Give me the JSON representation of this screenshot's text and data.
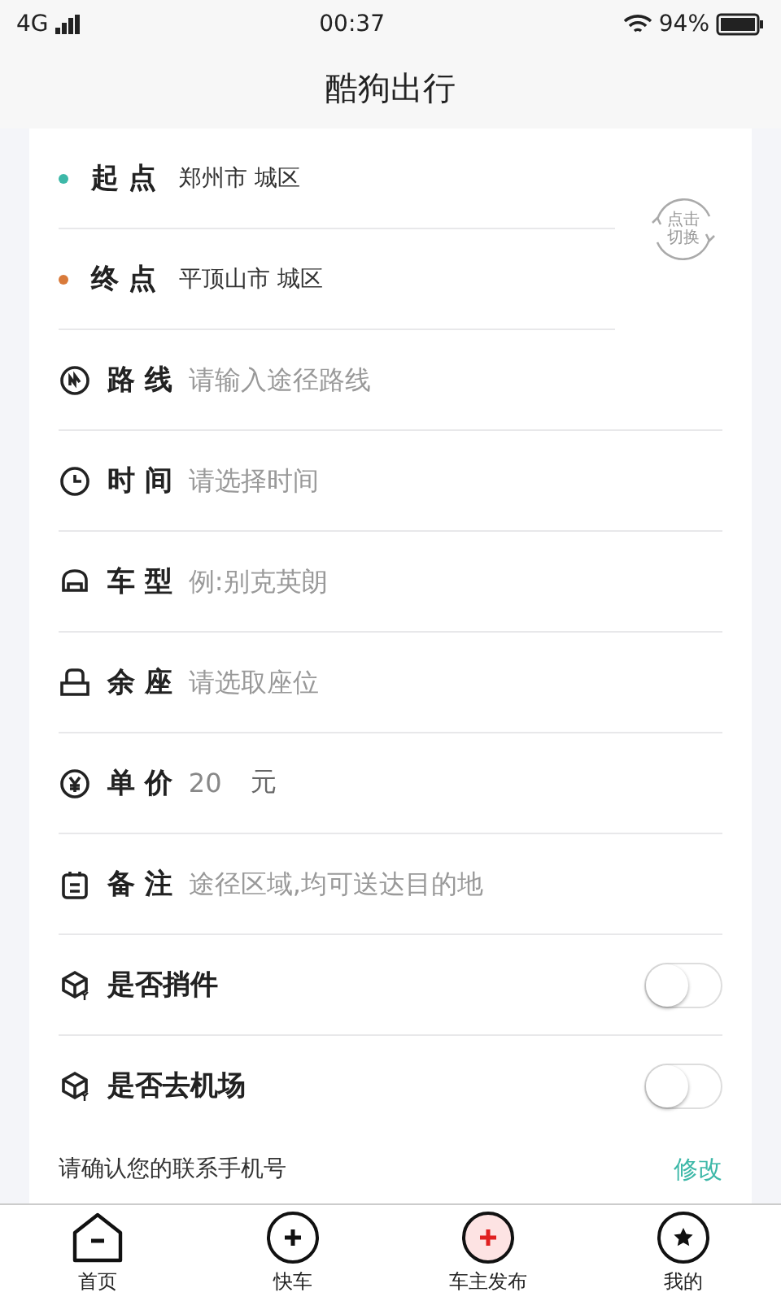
{
  "status_bar": {
    "network": "4G",
    "time": "00:37",
    "battery": "94%"
  },
  "header": {
    "title": "酷狗出行"
  },
  "locations": [
    {
      "label": "起 点",
      "value": "郑州市 城区",
      "color": "#3db8a8"
    },
    {
      "label": "终 点",
      "value": "平顶山市 城区",
      "color": "#d97a3a"
    }
  ],
  "swap_button": {
    "lines": [
      "点击",
      "切换"
    ]
  },
  "fields": [
    {
      "kind": "input",
      "label": "路 线",
      "placeholder": "请输入途径路线"
    },
    {
      "kind": "input",
      "label": "时 间",
      "placeholder": "请选择时间"
    },
    {
      "kind": "input",
      "label": "车 型",
      "placeholder": "例:别克英朗"
    },
    {
      "kind": "input",
      "label": "余 座",
      "placeholder": "请选取座位"
    },
    {
      "kind": "input",
      "label": "单 价",
      "value": "20",
      "unit": "元"
    },
    {
      "kind": "input",
      "label": "备 注",
      "placeholder": "途径区域,均可送达目的地"
    },
    {
      "kind": "toggle",
      "label": "是否捎件",
      "on": false
    },
    {
      "kind": "toggle",
      "label": "是否去机场",
      "on": false
    }
  ],
  "phone_notice": {
    "text": "请确认您的联系手机号",
    "action": "修改"
  },
  "tabs": [
    {
      "label": "首页",
      "selected": false
    },
    {
      "label": "快车",
      "selected": false
    },
    {
      "label": "车主发布",
      "selected": true
    },
    {
      "label": "我的",
      "selected": false
    }
  ]
}
